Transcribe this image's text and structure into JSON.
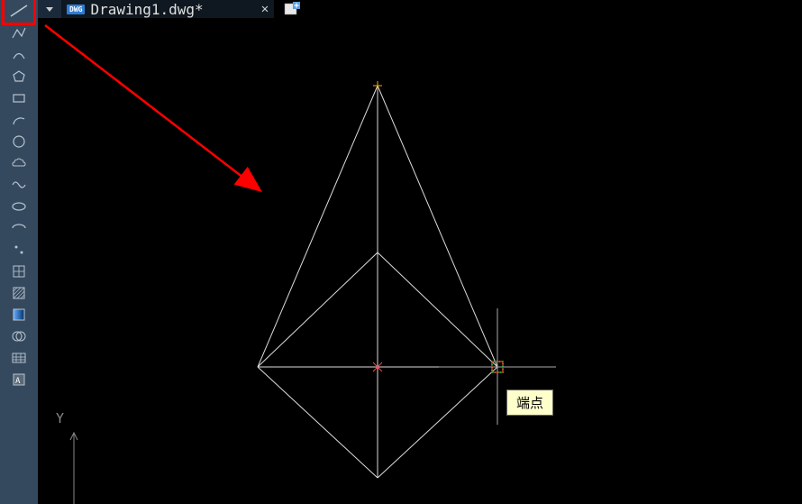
{
  "tabs": {
    "active_title": "Drawing1.dwg*",
    "file_icon_label": "DWG"
  },
  "tooltip": {
    "text": "端点"
  },
  "axes": {
    "y_label": "Y"
  },
  "toolbar": {
    "tools": [
      "line-tool",
      "polyline-tool",
      "arc-segment-tool",
      "polygon-tool",
      "rectangle-tool",
      "arc-tool",
      "circle-tool",
      "cloud-tool",
      "spline-tool",
      "ellipse-tool",
      "ellipse-arc-tool",
      "point-tool",
      "block-tool",
      "hatch-tool",
      "gradient-tool",
      "region-tool",
      "table-tool",
      "mtext-tool"
    ]
  },
  "colors": {
    "highlight": "#ff0000",
    "toolbar_bg": "#34495e",
    "snap_marker": "#ff0000",
    "center_marker": "#ff4444",
    "top_marker": "#ffaa00"
  }
}
